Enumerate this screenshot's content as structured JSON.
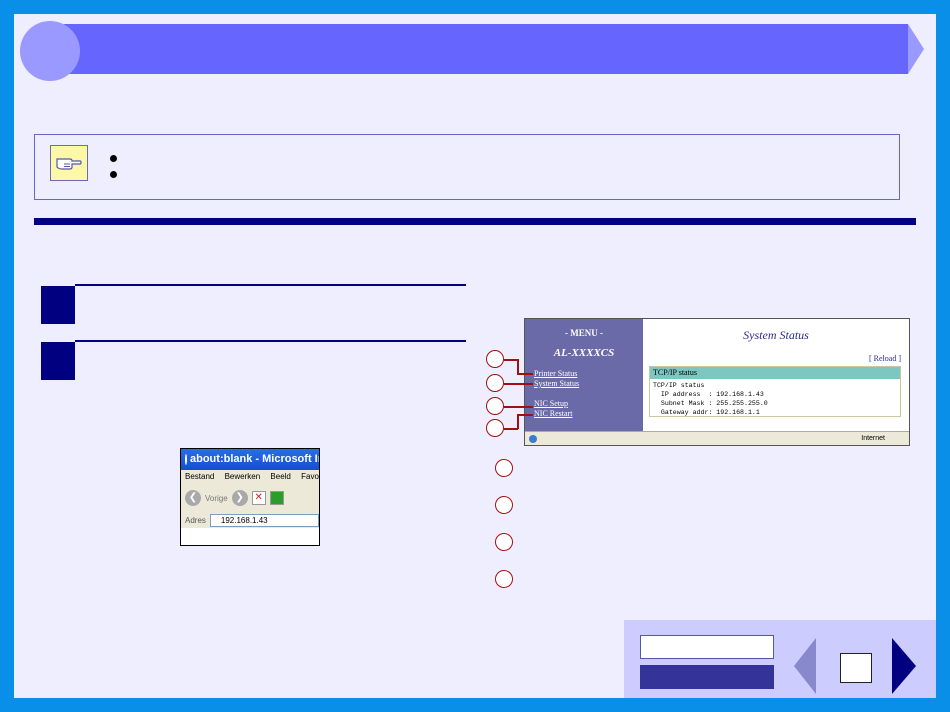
{
  "header": {
    "title": ""
  },
  "note": {
    "bullets": [
      "",
      ""
    ]
  },
  "steps": [
    {
      "num": "",
      "text": ""
    },
    {
      "num": "",
      "text": ""
    }
  ],
  "browser": {
    "title": "about:blank - Microsoft Inte",
    "menu": [
      "Bestand",
      "Bewerken",
      "Beeld",
      "Favo"
    ],
    "back_label": "Vorige",
    "address_label": "Adres",
    "address_value": "192.168.1.43"
  },
  "web_page": {
    "menu_title": "- MENU -",
    "model": "AL-XXXXCS",
    "menu_links": [
      "Printer Status",
      "System Status",
      "NIC Setup",
      "NIC Restart"
    ],
    "page_title": "System Status",
    "reload": "[ Reload ]",
    "tcp_header": "TCP/IP status",
    "tcp_lines": [
      "TCP/IP status",
      "  IP address  : 192.168.1.43",
      "  Subnet Mask : 255.255.255.0",
      "  Gateway addr: 192.168.1.1"
    ],
    "status_zone": "Internet"
  },
  "nav": {
    "contents_label": "",
    "index_label": "",
    "page_number": ""
  },
  "colors": {
    "frame": "#0a8fe8",
    "accent": "#000080",
    "header_bar": "#6666ff",
    "callout": "#a01010"
  }
}
